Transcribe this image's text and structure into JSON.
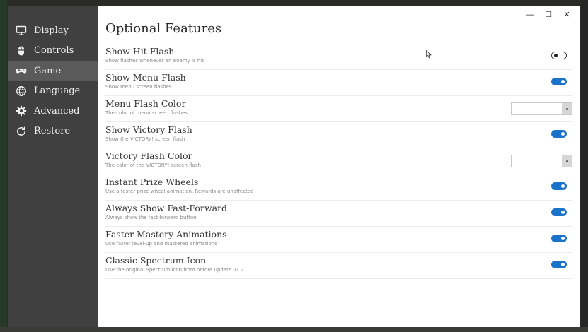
{
  "sidebar": {
    "items": [
      {
        "label": "Display",
        "icon": "monitor-icon",
        "active": false
      },
      {
        "label": "Controls",
        "icon": "mouse-icon",
        "active": false
      },
      {
        "label": "Game",
        "icon": "gamepad-icon",
        "active": true
      },
      {
        "label": "Language",
        "icon": "globe-icon",
        "active": false
      },
      {
        "label": "Advanced",
        "icon": "gear-icon",
        "active": false
      },
      {
        "label": "Restore",
        "icon": "restore-icon",
        "active": false
      }
    ]
  },
  "window_controls": {
    "minimize": "—",
    "maximize": "☐",
    "close": "✕"
  },
  "page": {
    "title": "Optional Features"
  },
  "settings": [
    {
      "label": "Show Hit Flash",
      "description": "Show flashes whenever an enemy is hit",
      "control": "toggle",
      "on": false
    },
    {
      "label": "Show Menu Flash",
      "description": "Show menu screen flashes",
      "control": "toggle",
      "on": true
    },
    {
      "label": "Menu Flash Color",
      "description": "The color of menu screen flashes",
      "control": "color",
      "value": ""
    },
    {
      "label": "Show Victory Flash",
      "description": "Show the VICTORY! screen flash",
      "control": "toggle",
      "on": true
    },
    {
      "label": "Victory Flash Color",
      "description": "The color of the VICTORY! screen flash",
      "control": "color",
      "value": ""
    },
    {
      "label": "Instant Prize Wheels",
      "description": "Use a faster prize wheel animation. Rewards are unaffected",
      "control": "toggle",
      "on": true
    },
    {
      "label": "Always Show Fast-Forward",
      "description": "Always show the fast-forward button",
      "control": "toggle",
      "on": true
    },
    {
      "label": "Faster Mastery Animations",
      "description": "Use faster level-up and mastered animations",
      "control": "toggle",
      "on": true
    },
    {
      "label": "Classic Spectrum Icon",
      "description": "Use the original Spectrum icon from before update v1.2",
      "control": "toggle",
      "on": true
    }
  ],
  "colors": {
    "accent": "#1a73c8",
    "sidebar_bg": "#404040",
    "sidebar_active": "#5a5a5a"
  }
}
